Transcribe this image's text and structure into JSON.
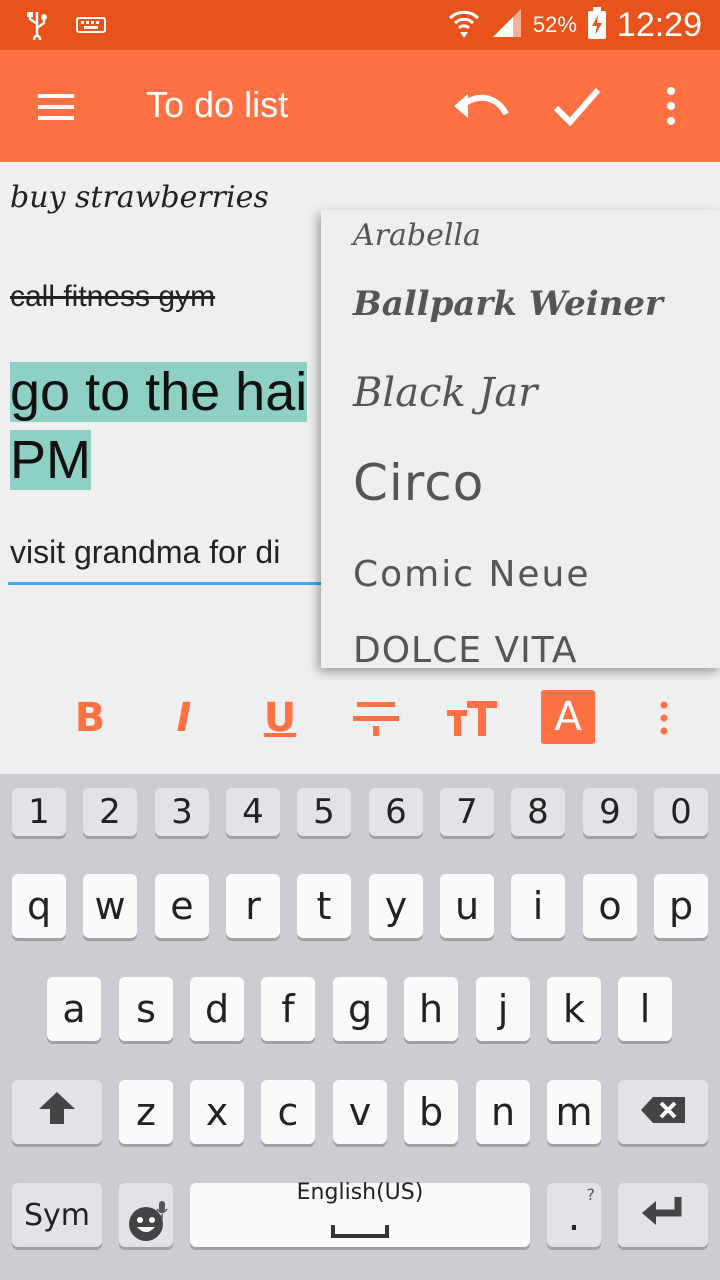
{
  "status_bar": {
    "battery": "52%",
    "time": "12:29"
  },
  "app_bar": {
    "title": "To do list"
  },
  "notes": [
    {
      "text": "buy strawberries"
    },
    {
      "text": "call fitness gym"
    },
    {
      "line1": "go to the hai",
      "line2": "PM"
    },
    {
      "text": "visit grandma for di"
    }
  ],
  "font_menu": {
    "items": [
      "Arabella",
      "Ballpark Weiner",
      "Black Jar",
      "Circo",
      "Comic Neue",
      "DOLCE VITA"
    ]
  },
  "format_toolbar": {
    "bold": "B",
    "italic": "I",
    "underline": "U",
    "text_color": "A"
  },
  "keyboard": {
    "numbers": [
      "1",
      "2",
      "3",
      "4",
      "5",
      "6",
      "7",
      "8",
      "9",
      "0"
    ],
    "row1": [
      "q",
      "w",
      "e",
      "r",
      "t",
      "y",
      "u",
      "i",
      "o",
      "p"
    ],
    "row2": [
      "a",
      "s",
      "d",
      "f",
      "g",
      "h",
      "j",
      "k",
      "l"
    ],
    "row3": [
      "z",
      "x",
      "c",
      "v",
      "b",
      "n",
      "m"
    ],
    "sym": "Sym",
    "space_label": "English(US)",
    "period": ".",
    "period_hint": "?"
  },
  "colors": {
    "accent": "#ff7043",
    "status_bar": "#e8531b",
    "highlight": "#8fd0c5",
    "focus_line": "#3fa9f5"
  },
  "icons": [
    "usb-icon",
    "keyboard-icon",
    "wifi-icon",
    "signal-icon",
    "battery-charging-icon",
    "menu-icon",
    "undo-icon",
    "check-icon",
    "more-vert-icon",
    "strikethrough-icon",
    "text-size-icon",
    "shift-icon",
    "backspace-icon",
    "emoji-icon",
    "mic-icon",
    "enter-icon"
  ]
}
